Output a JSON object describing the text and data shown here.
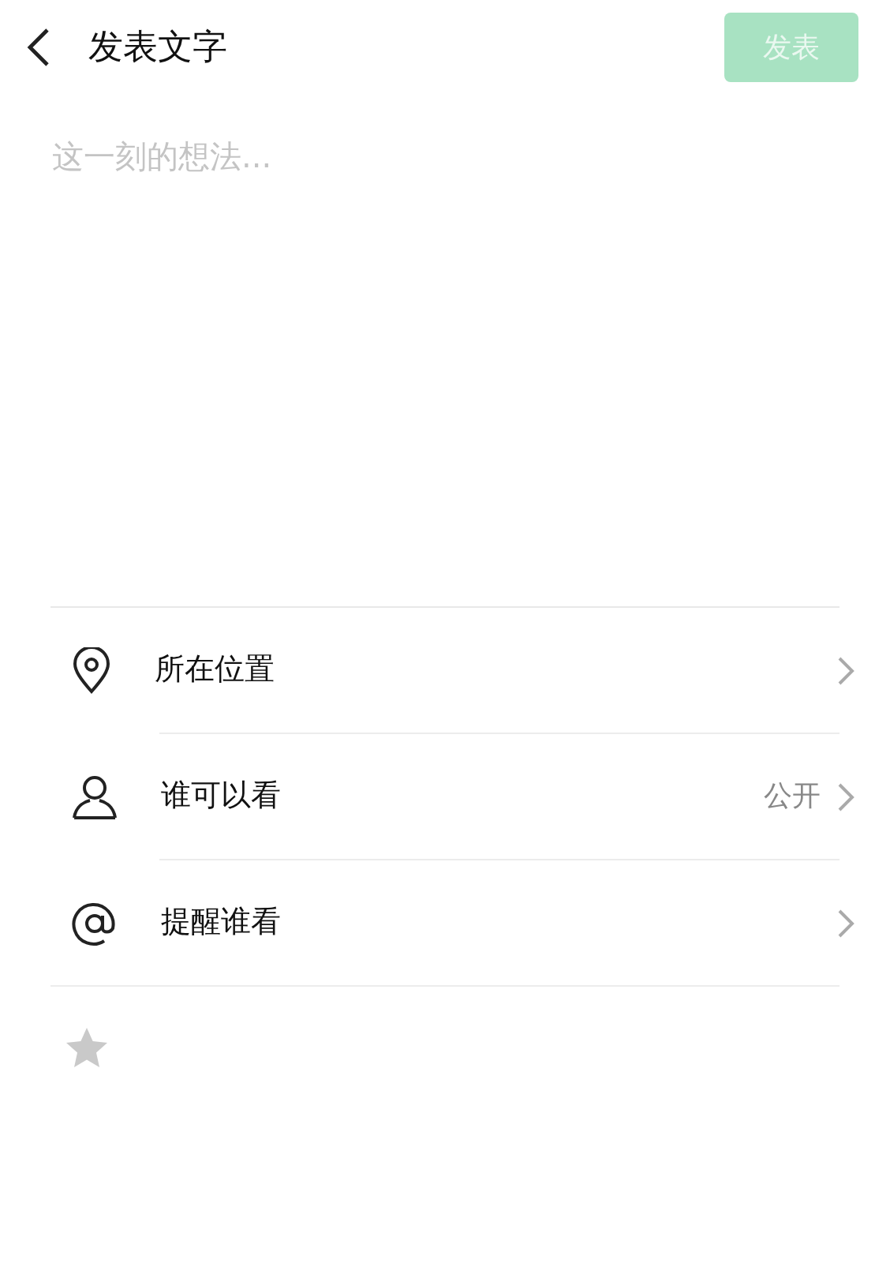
{
  "header": {
    "title": "发表文字",
    "publish_button": {
      "label": "发表",
      "disabled": true
    }
  },
  "post_field": {
    "placeholder": "这一刻的想法..."
  },
  "options": [
    {
      "kind": "location",
      "label": "所在位置"
    },
    {
      "kind": "visibility",
      "label": "谁可以看",
      "value": "公开"
    },
    {
      "kind": "mention",
      "label": "提醒谁看"
    }
  ]
}
